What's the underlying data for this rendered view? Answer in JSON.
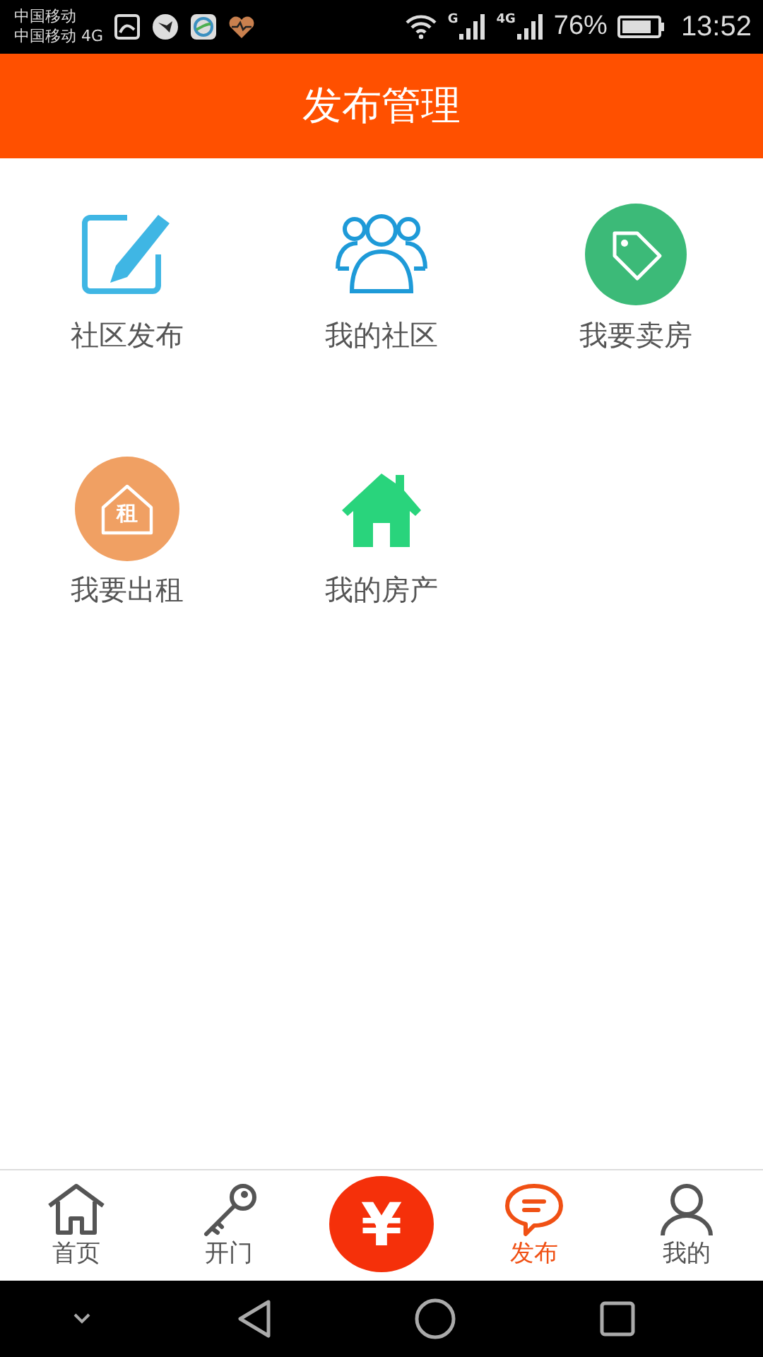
{
  "status_bar": {
    "carriers": [
      "中国移动",
      "中国移动 4G"
    ],
    "signals": [
      {
        "label": "G"
      },
      {
        "label": "4G"
      }
    ],
    "battery_text": "76%",
    "time": "13:52"
  },
  "header": {
    "title": "发布管理"
  },
  "grid": [
    {
      "kind": "pencil",
      "label": "社区发布"
    },
    {
      "kind": "people",
      "label": "我的社区"
    },
    {
      "kind": "tag",
      "label": "我要卖房"
    },
    {
      "kind": "rent",
      "label": "我要出租",
      "icon_text": "租"
    },
    {
      "kind": "house",
      "label": "我的房产"
    }
  ],
  "tabs": [
    {
      "kind": "home",
      "label": "首页",
      "selected": false
    },
    {
      "kind": "key",
      "label": "开门",
      "selected": false
    },
    {
      "kind": "center",
      "symbol": "¥"
    },
    {
      "kind": "chat",
      "label": "发布",
      "selected": true
    },
    {
      "kind": "user",
      "label": "我的",
      "selected": false
    }
  ]
}
